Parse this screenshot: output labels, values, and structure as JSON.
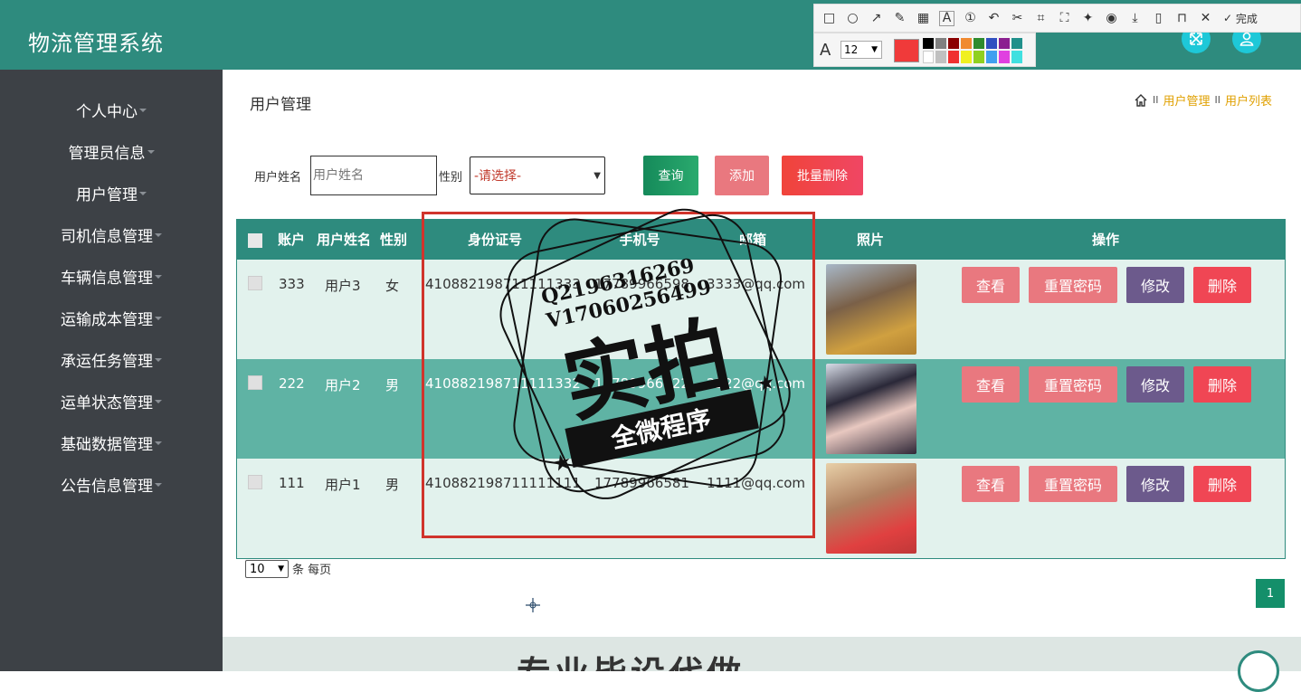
{
  "app": {
    "title": "物流管理系统"
  },
  "sidebar": {
    "items": [
      {
        "label": "个人中心"
      },
      {
        "label": "管理员信息"
      },
      {
        "label": "用户管理"
      },
      {
        "label": "司机信息管理"
      },
      {
        "label": "车辆信息管理"
      },
      {
        "label": "运输成本管理"
      },
      {
        "label": "承运任务管理"
      },
      {
        "label": "运单状态管理"
      },
      {
        "label": "基础数据管理"
      },
      {
        "label": "公告信息管理"
      }
    ]
  },
  "page": {
    "title": "用户管理",
    "breadcrumb": {
      "sep": "II",
      "item1": "用户管理",
      "item2": "用户列表"
    }
  },
  "search": {
    "name_label": "用户姓名",
    "name_placeholder": "用户姓名",
    "gender_label": "性别",
    "gender_value": "-请选择-",
    "query_btn": "查询",
    "add_btn": "添加",
    "batch_delete_btn": "批量删除"
  },
  "table": {
    "headers": {
      "account": "账户",
      "name": "用户姓名",
      "gender": "性别",
      "id_card": "身份证号",
      "phone": "手机号",
      "email": "邮箱",
      "photo": "照片",
      "actions": "操作"
    },
    "rows": [
      {
        "account": "333",
        "name": "用户3",
        "gender": "女",
        "id_card": "410882198711111333",
        "phone": "17789966598",
        "email": "3333@qq.com"
      },
      {
        "account": "222",
        "name": "用户2",
        "gender": "男",
        "id_card": "410882198711111332",
        "phone": "17789966322",
        "email": "2222@qq.com"
      },
      {
        "account": "111",
        "name": "用户1",
        "gender": "男",
        "id_card": "410882198711111111",
        "phone": "17789966581",
        "email": "1111@qq.com"
      }
    ],
    "row_actions": {
      "view": "查看",
      "reset": "重置密码",
      "edit": "修改",
      "delete": "删除"
    }
  },
  "pager": {
    "size": "10",
    "suffix": "条 每页",
    "current": "1"
  },
  "toolbar": {
    "font_size": "12",
    "done_label": "完成"
  },
  "footer": {
    "text": "专业毕设代做"
  },
  "watermark": {
    "line1": "Q2196316269",
    "line2": "V17060256499",
    "big": "实拍",
    "banner": "全微程序"
  },
  "colors": {
    "brand": "#2e8b7e",
    "sidebar": "#3d4146",
    "row_light": "#e2f2ed",
    "row_dark": "#5fb3a4",
    "view_btn": "#e9787f",
    "edit_btn": "#6c5a8c",
    "delete_btn": "#f04654",
    "query_btn": "#1a9a6a",
    "add_btn": "#e9787f",
    "batch_btn": "#f04654"
  }
}
